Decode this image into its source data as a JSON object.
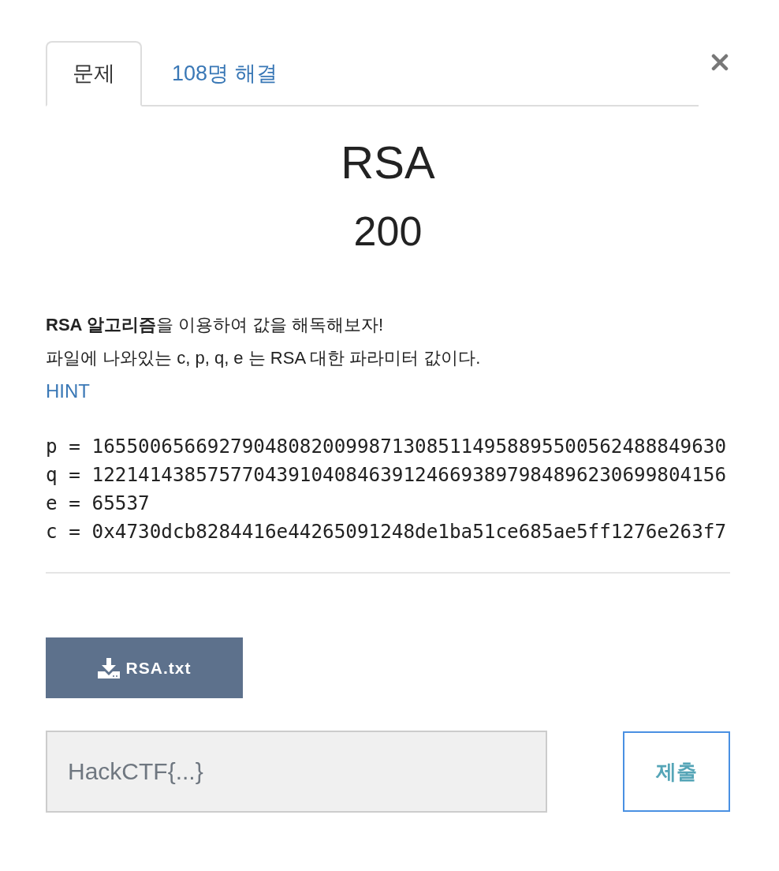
{
  "tabs": [
    {
      "label": "문제",
      "selected": true
    },
    {
      "label": "108명 해결",
      "selected": false
    }
  ],
  "challenge": {
    "title": "RSA",
    "points": "200"
  },
  "description": {
    "lines": [
      "**RSA 알고리즘**을 이용하여 값을 해독해보자!",
      "파일에 나와있는 c, p, q, e 는 RSA 대한 파라미터 값이다."
    ],
    "hint_link": "HINT"
  },
  "code_lines": [
    "p = 1655006566927904808200998713085114958895500562488849630",
    "q = 1221414385757704391040846391246693897984896230699804156",
    "e = 65537",
    "c = 0x4730dcb8284416e44265091248de1ba51ce685ae5ff1276e263f7"
  ],
  "download_button": {
    "label": "RSA.txt"
  },
  "flag_input": {
    "placeholder": "HackCTF{...}"
  },
  "submit_button": {
    "label": "제출"
  }
}
